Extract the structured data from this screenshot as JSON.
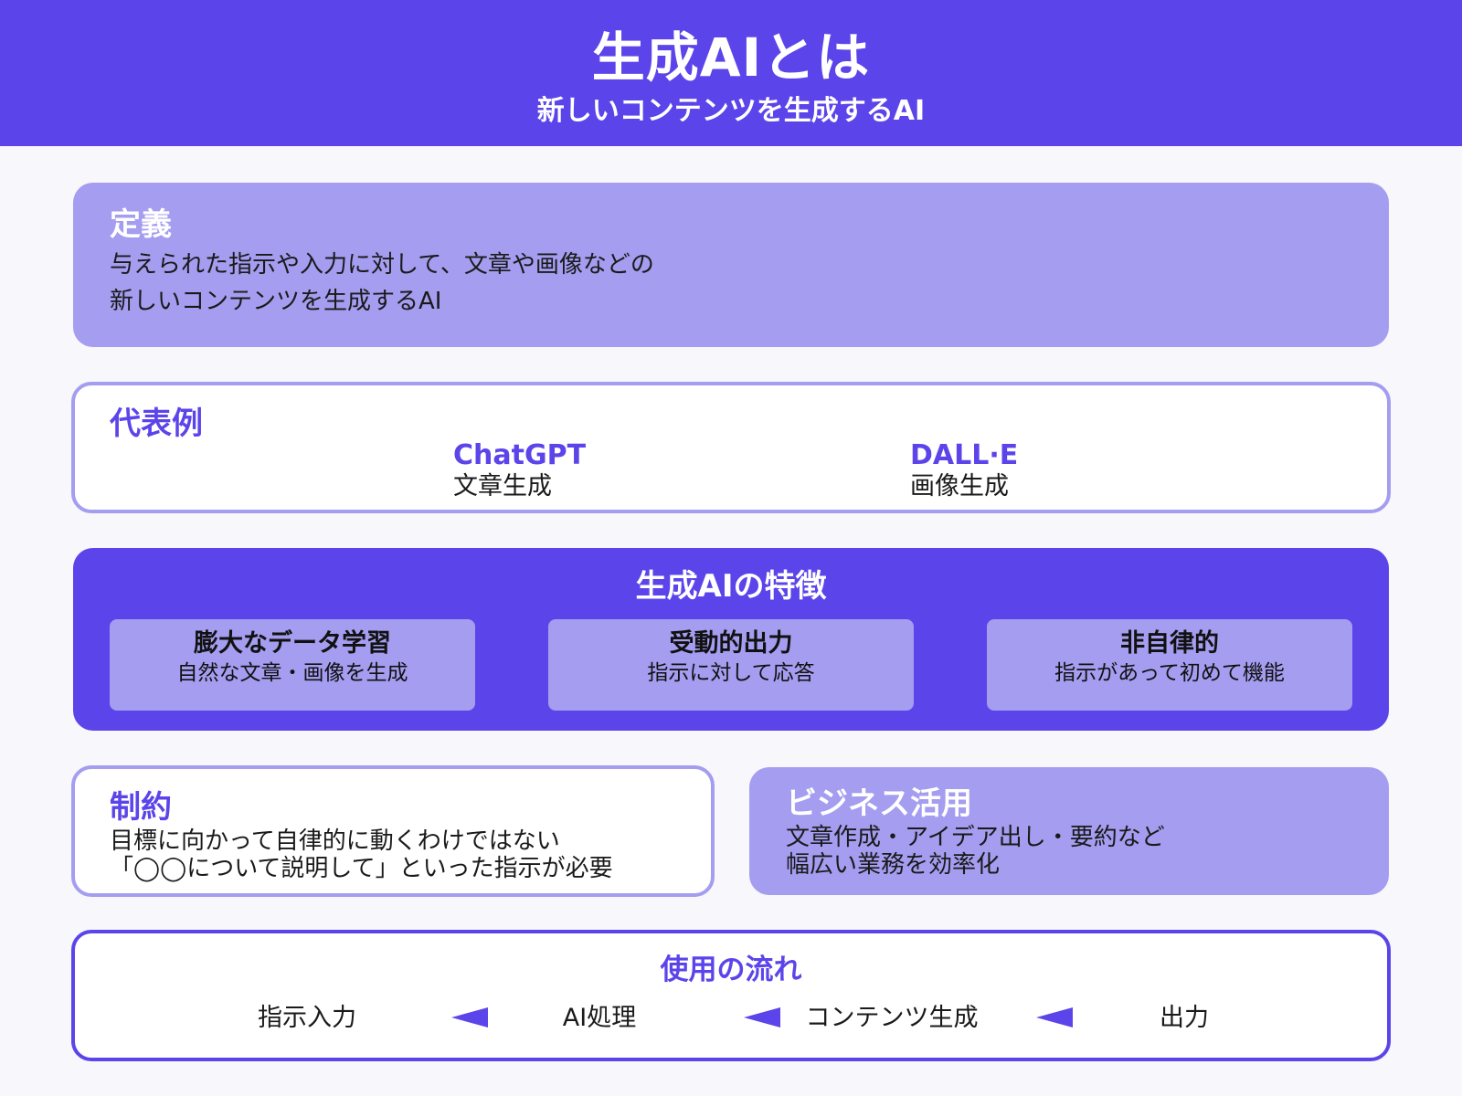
{
  "header": {
    "title": "生成AIとは",
    "subtitle": "新しいコンテンツを生成するAI"
  },
  "definition": {
    "title": "定義",
    "lines": [
      "与えられた指示や入力に対して、文章や画像などの",
      "新しいコンテンツを生成するAI"
    ]
  },
  "examples": {
    "title": "代表例",
    "items": [
      {
        "name": "ChatGPT",
        "desc": "文章生成"
      },
      {
        "name": "DALL·E",
        "desc": "画像生成"
      }
    ]
  },
  "features": {
    "title": "生成AIの特徴",
    "items": [
      {
        "title": "膨大なデータ学習",
        "desc": "自然な文章・画像を生成"
      },
      {
        "title": "受動的出力",
        "desc": "指示に対して応答"
      },
      {
        "title": "非自律的",
        "desc": "指示があって初めて機能"
      }
    ]
  },
  "constraints": {
    "title": "制約",
    "lines": [
      "目標に向かって自律的に動くわけではない",
      "「◯◯について説明して」といった指示が必要"
    ]
  },
  "business": {
    "title": "ビジネス活用",
    "lines": [
      "文章作成・アイデア出し・要約など",
      "幅広い業務を効率化"
    ]
  },
  "flow": {
    "title": "使用の流れ",
    "steps": [
      "指示入力",
      "AI処理",
      "コンテンツ生成",
      "出力"
    ]
  },
  "colors": {
    "accent": "#5b45ea",
    "light_accent": "#a49df0",
    "background": "#f7f7fc"
  }
}
